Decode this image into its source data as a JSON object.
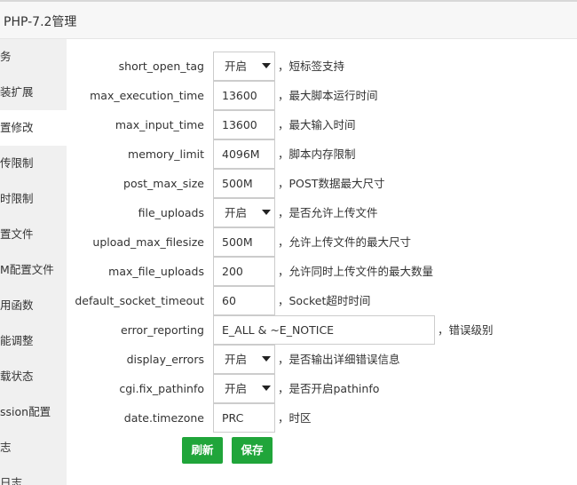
{
  "window": {
    "title": "PHP-7.2管理"
  },
  "sidebar": {
    "items": [
      {
        "label": "务"
      },
      {
        "label": "装扩展"
      },
      {
        "label": "置修改",
        "active": true
      },
      {
        "label": "传限制"
      },
      {
        "label": "时限制"
      },
      {
        "label": "置文件"
      },
      {
        "label": "M配置文件"
      },
      {
        "label": "用函数"
      },
      {
        "label": "能调整"
      },
      {
        "label": "载状态"
      },
      {
        "label": "ssion配置"
      },
      {
        "label": "志"
      },
      {
        "label": "日志"
      }
    ]
  },
  "settings": {
    "short_open_tag": {
      "label": "short_open_tag",
      "value": "开启",
      "desc": "，短标签支持"
    },
    "max_execution_time": {
      "label": "max_execution_time",
      "value": "13600",
      "desc": "，最大脚本运行时间"
    },
    "max_input_time": {
      "label": "max_input_time",
      "value": "13600",
      "desc": "，最大输入时间"
    },
    "memory_limit": {
      "label": "memory_limit",
      "value": "4096M",
      "desc": "，脚本内存限制"
    },
    "post_max_size": {
      "label": "post_max_size",
      "value": "500M",
      "desc": "，POST数据最大尺寸"
    },
    "file_uploads": {
      "label": "file_uploads",
      "value": "开启",
      "desc": "，是否允许上传文件"
    },
    "upload_max_filesize": {
      "label": "upload_max_filesize",
      "value": "500M",
      "desc": "，允许上传文件的最大尺寸"
    },
    "max_file_uploads": {
      "label": "max_file_uploads",
      "value": "200",
      "desc": "，允许同时上传文件的最大数量"
    },
    "default_socket_timeout": {
      "label": "default_socket_timeout",
      "value": "60",
      "desc": "，Socket超时时间"
    },
    "error_reporting": {
      "label": "error_reporting",
      "value": "E_ALL & ~E_NOTICE",
      "desc": "，错误级别"
    },
    "display_errors": {
      "label": "display_errors",
      "value": "开启",
      "desc": "，是否输出详细错误信息"
    },
    "cgi_fix_pathinfo": {
      "label": "cgi.fix_pathinfo",
      "value": "开启",
      "desc": "，是否开启pathinfo"
    },
    "date_timezone": {
      "label": "date.timezone",
      "value": "PRC",
      "desc": "，时区"
    }
  },
  "buttons": {
    "refresh": "刷新",
    "save": "保存"
  }
}
